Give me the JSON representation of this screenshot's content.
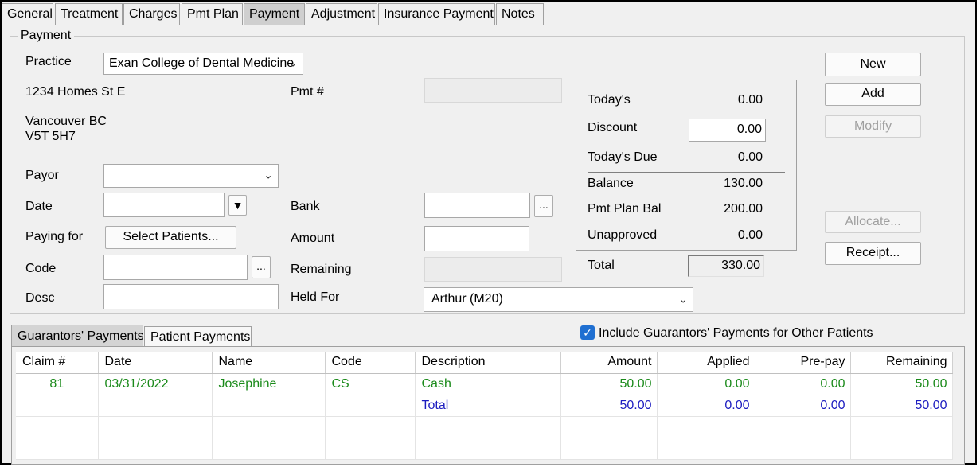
{
  "tabs": [
    "General",
    "Treatment",
    "Charges",
    "Pmt Plan",
    "Payment",
    "Adjustment",
    "Insurance Payment",
    "Notes"
  ],
  "active_tab": "Payment",
  "group_title": "Payment",
  "practice": {
    "label": "Practice",
    "value": "Exan College of Dental Medicine",
    "address1": "1234 Homes St E",
    "address2": "Vancouver BC",
    "address3": "V5T 5H7"
  },
  "fields": {
    "payor_label": "Payor",
    "payor_value": "",
    "date_label": "Date",
    "date_value": "",
    "paying_for_label": "Paying for",
    "select_patients_label": "Select Patients...",
    "code_label": "Code",
    "code_value": "",
    "desc_label": "Desc",
    "desc_value": "",
    "pmt_label": "Pmt #",
    "pmt_value": "",
    "bank_label": "Bank",
    "bank_value": "",
    "amount_label": "Amount",
    "amount_value": "",
    "remaining_label": "Remaining",
    "remaining_value": "",
    "held_for_label": "Held For",
    "held_for_value": "Arthur (M20)",
    "ellipsis": "..."
  },
  "summary": {
    "todays_label": "Today's",
    "todays_value": "0.00",
    "discount_label": "Discount",
    "discount_value": "0.00",
    "todays_due_label": "Today's Due",
    "todays_due_value": "0.00",
    "balance_label": "Balance",
    "balance_value": "130.00",
    "pmt_plan_bal_label": "Pmt Plan Bal",
    "pmt_plan_bal_value": "200.00",
    "unapproved_label": "Unapproved",
    "unapproved_value": "0.00",
    "total_label": "Total",
    "total_value": "330.00"
  },
  "buttons": {
    "new": "New",
    "add": "Add",
    "modify": "Modify",
    "allocate": "Allocate...",
    "receipt": "Receipt..."
  },
  "subtabs": [
    "Guarantors' Payments",
    "Patient Payments"
  ],
  "include_checkbox": {
    "label": "Include Guarantors' Payments for Other Patients",
    "checked": true
  },
  "grid": {
    "columns": [
      "Claim #",
      "Date",
      "Name",
      "Code",
      "Description",
      "Amount",
      "Applied",
      "Pre-pay",
      "Remaining"
    ],
    "rows": [
      [
        "81",
        "03/31/2022",
        "Josephine",
        "CS",
        "Cash",
        "50.00",
        "0.00",
        "0.00",
        "50.00"
      ],
      [
        "",
        "",
        "",
        "",
        "Total",
        "50.00",
        "0.00",
        "0.00",
        "50.00"
      ]
    ]
  },
  "colors": {
    "row_text": "#1a8a1a",
    "total_text": "#1c1cc0",
    "checkbox": "#1f6fd1"
  }
}
